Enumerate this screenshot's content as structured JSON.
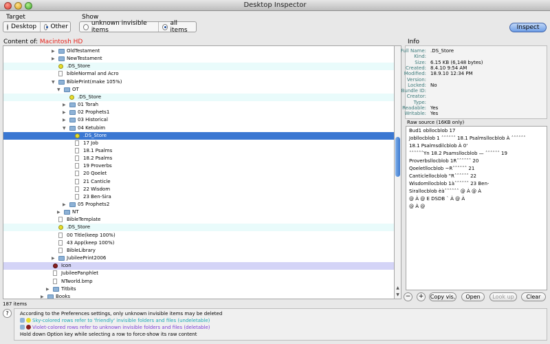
{
  "window": {
    "title": "Desktop Inspector"
  },
  "target": {
    "label": "Target",
    "options": [
      "Desktop",
      "Other"
    ],
    "selected": 1
  },
  "show": {
    "label": "Show",
    "options": [
      "unknown invisible items",
      "all items"
    ],
    "selected": 1
  },
  "inspect_label": "Inspect",
  "content_of": {
    "label": "Content of:",
    "value": "Macintosh HD"
  },
  "tree_rows": [
    {
      "label": "OldTestament",
      "indent": 5,
      "icon": "folder",
      "tri": "right"
    },
    {
      "label": "NewTestament",
      "indent": 5,
      "icon": "folder",
      "tri": "right"
    },
    {
      "label": ".DS_Store",
      "indent": 5,
      "icon": "smile",
      "tri": "",
      "style": "sky"
    },
    {
      "label": "bibleNormal and Acro",
      "indent": 5,
      "icon": "file",
      "tri": ""
    },
    {
      "label": "BiblePrint(make 105%)",
      "indent": 5,
      "icon": "folder",
      "tri": "down"
    },
    {
      "label": "OT",
      "indent": 6,
      "icon": "folder",
      "tri": "down"
    },
    {
      "label": ".DS_Store",
      "indent": 7,
      "icon": "smile",
      "tri": "",
      "style": "sky"
    },
    {
      "label": "01 Torah",
      "indent": 7,
      "icon": "folder",
      "tri": "right"
    },
    {
      "label": "02 Prophets1",
      "indent": 7,
      "icon": "folder",
      "tri": "right"
    },
    {
      "label": "03 Historical",
      "indent": 7,
      "icon": "folder",
      "tri": "right"
    },
    {
      "label": "04 Ketubim",
      "indent": 7,
      "icon": "folder",
      "tri": "down"
    },
    {
      "label": ".DS_Store",
      "indent": 8,
      "icon": "smile",
      "tri": "",
      "style": "sel"
    },
    {
      "label": "17 Job",
      "indent": 8,
      "icon": "file",
      "tri": ""
    },
    {
      "label": "18.1 Psalms",
      "indent": 8,
      "icon": "file",
      "tri": ""
    },
    {
      "label": "18.2 Psalms",
      "indent": 8,
      "icon": "file",
      "tri": ""
    },
    {
      "label": "19 Proverbs",
      "indent": 8,
      "icon": "file",
      "tri": ""
    },
    {
      "label": "20 Qoelet",
      "indent": 8,
      "icon": "file",
      "tri": ""
    },
    {
      "label": "21 Canticle",
      "indent": 8,
      "icon": "file",
      "tri": ""
    },
    {
      "label": "22 Wisdom",
      "indent": 8,
      "icon": "file",
      "tri": ""
    },
    {
      "label": "23 Ben-Sira",
      "indent": 8,
      "icon": "file",
      "tri": ""
    },
    {
      "label": "05 Prophets2",
      "indent": 7,
      "icon": "folder",
      "tri": "right"
    },
    {
      "label": "NT",
      "indent": 6,
      "icon": "folder",
      "tri": "right"
    },
    {
      "label": "BibleTemplate",
      "indent": 5,
      "icon": "file",
      "tri": ""
    },
    {
      "label": ".DS_Store",
      "indent": 5,
      "icon": "smile",
      "tri": "",
      "style": "sky"
    },
    {
      "label": "00 Title(keep 100%)",
      "indent": 5,
      "icon": "file",
      "tri": ""
    },
    {
      "label": "43 App(keep 100%)",
      "indent": 5,
      "icon": "file",
      "tri": ""
    },
    {
      "label": "BibleLibrary",
      "indent": 5,
      "icon": "file",
      "tri": ""
    },
    {
      "label": "JubileePrint2006",
      "indent": 5,
      "icon": "folder",
      "tri": "right"
    },
    {
      "label": "Icon",
      "indent": 4,
      "icon": "dot",
      "tri": "",
      "style": "vio"
    },
    {
      "label": "JubileePanphlet",
      "indent": 4,
      "icon": "file",
      "tri": ""
    },
    {
      "label": "NTworld.bmp",
      "indent": 4,
      "icon": "file",
      "tri": ""
    },
    {
      "label": "Titbits",
      "indent": 4,
      "icon": "folder",
      "tri": "right"
    },
    {
      "label": "Books",
      "indent": 3,
      "icon": "folder",
      "tri": "right"
    }
  ],
  "item_count": "187 items",
  "info": {
    "title": "Info",
    "fields": [
      {
        "k": "Full Name:",
        "v": ".DS_Store"
      },
      {
        "k": "Kind:",
        "v": ""
      },
      {
        "k": "Size:",
        "v": "6.15 KB (6,148 bytes)"
      },
      {
        "k": "Created:",
        "v": "8.4.10  9:54 AM"
      },
      {
        "k": "Modified:",
        "v": "18.9.10  12:34 PM"
      },
      {
        "k": "Version:",
        "v": ""
      },
      {
        "k": "Locked:",
        "v": "No"
      },
      {
        "k": "Bundle ID:",
        "v": ""
      },
      {
        "k": "Creator:",
        "v": ""
      },
      {
        "k": "Type:",
        "v": ""
      },
      {
        "k": "Readable:",
        "v": "Yes"
      },
      {
        "k": "Writable:",
        "v": "Yes"
      }
    ]
  },
  "raw": {
    "title": "Raw source (16KB only)",
    "lines": [
      "Bud1                    obllocblob          17",
      "Jobllocblob 1 ˆˆˆˆˆˆ   18.1 Psalmsllocblob À ˆˆˆˆˆˆ",
      "18.1 Psalmsdilcblob    À 0'",
      "ˆˆˆˆˆˆYn 18.2 Psamsllocblob — ˆˆˆˆˆˆ 19",
      "Proverbsllocblob 1Rˆˆˆˆˆˆ      20",
      "Qoeletllocblob ~Rˆˆˆˆˆˆ 21",
      "Canticlellocblob \"Rˆˆˆˆˆˆ       22",
      "Wisdomllocblob 1àˆˆˆˆˆˆ 23 Ben-",
      "Sirallocblob èàˆˆˆˆˆˆ       @ À          @ À",
      "   @ À         @    E      DSDB    ` À          @ À",
      "   @ À                   @"
    ]
  },
  "buttons": {
    "minus": "−",
    "plus": "+",
    "copy": "Copy vis.",
    "open": "Open",
    "lookup": "Look up",
    "clear": "Clear"
  },
  "help_icon": "?",
  "messages": [
    "According to the Preferences settings, only unknown invisible items may be deleted",
    "Sky-colored rows refer to 'friendly' invisible folders and files (undeletable)",
    "Violet-colored rows refer to unknown invisible folders and files (deletable)",
    "Hold down Option key while selecting a row to force-show its raw content"
  ],
  "colors": {
    "sky": "#e9fbfb",
    "violet": "#d4d4f7",
    "selected": "#3a77d2",
    "content_value": "#e8221a",
    "sky_text": "#17a7b3",
    "violet_text": "#7a3bd6"
  }
}
